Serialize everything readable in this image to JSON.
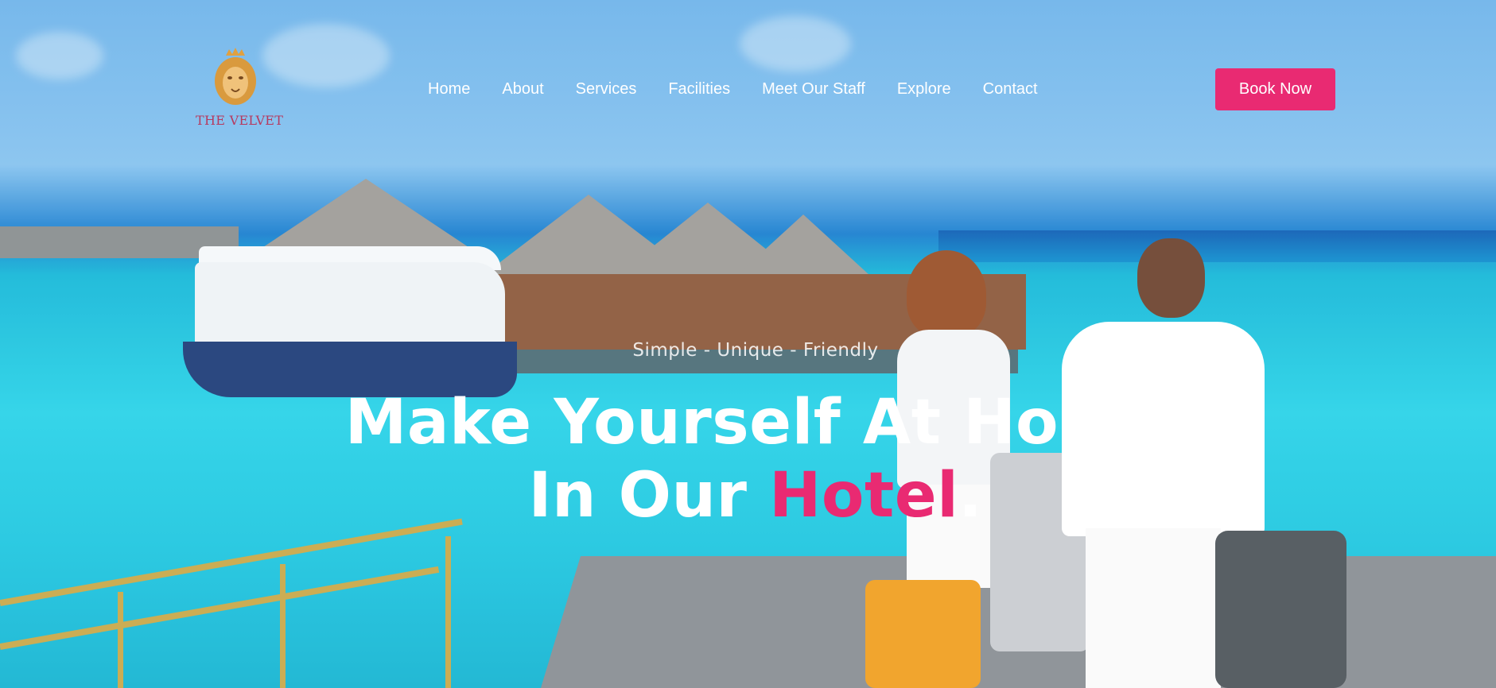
{
  "brand": {
    "name": "THE VELVET",
    "logo_icon": "lion-crown-icon"
  },
  "nav": {
    "items": [
      {
        "label": "Home"
      },
      {
        "label": "About"
      },
      {
        "label": "Services"
      },
      {
        "label": "Facilities"
      },
      {
        "label": "Meet Our Staff"
      },
      {
        "label": "Explore"
      },
      {
        "label": "Contact"
      }
    ]
  },
  "cta": {
    "book_label": "Book Now"
  },
  "hero": {
    "tagline": "Simple - Unique - Friendly",
    "headline_line1": "Make Yourself At Home",
    "headline_line2_prefix": "In Our ",
    "headline_line2_accent": "Hotel",
    "headline_line2_suffix": "."
  },
  "colors": {
    "accent": "#e92a72",
    "text": "#ffffff"
  }
}
